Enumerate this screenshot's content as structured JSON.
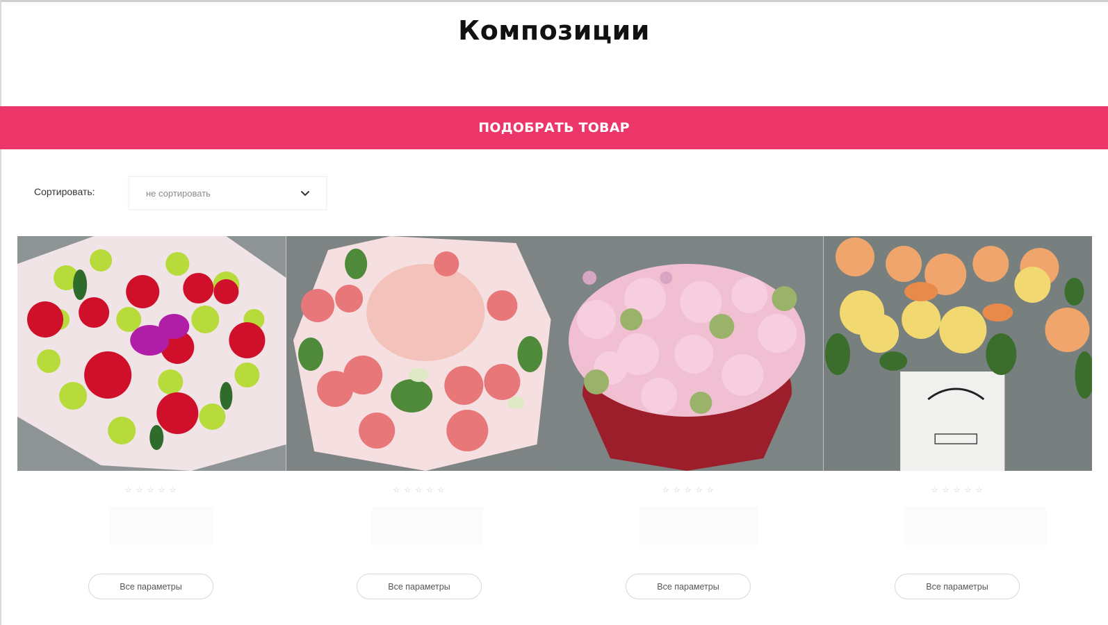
{
  "page": {
    "title": "Композиции"
  },
  "pick_button": {
    "label": "ПОДОБРАТЬ ТОВАР"
  },
  "sort": {
    "label": "Сортировать:",
    "selected": "не сортировать"
  },
  "products": [
    {
      "image": "bouquet-red-roses-green-chrysanthemums",
      "rating_stars": 5,
      "rating_value": 0,
      "params_label": "Все параметры"
    },
    {
      "image": "bouquet-pink-hydrangea-roses",
      "rating_stars": 5,
      "rating_value": 0,
      "params_label": "Все параметры"
    },
    {
      "image": "heart-box-pink-roses",
      "rating_stars": 5,
      "rating_value": 0,
      "params_label": "Все параметры"
    },
    {
      "image": "white-box-peach-dahlias",
      "rating_stars": 5,
      "rating_value": 0,
      "params_label": "Все параметры"
    }
  ],
  "colors": {
    "accent": "#ec3568",
    "star_empty": "#c9c9c9"
  },
  "icons": {
    "sort_chevron": "chevron-down-icon",
    "rating": "star-icon"
  }
}
